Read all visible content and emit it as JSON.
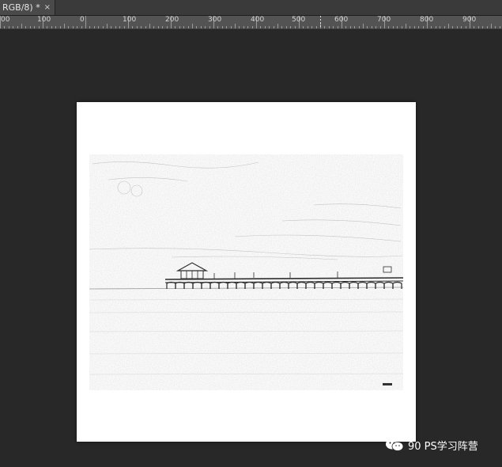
{
  "tabbar": {
    "tab_title": "RGB/8) *",
    "close_glyph": "×"
  },
  "ruler": {
    "labels": [
      "00",
      "100",
      "0",
      "100",
      "200",
      "300",
      "400",
      "500",
      "600",
      "700",
      "800",
      "900"
    ]
  },
  "canvas": {
    "image_description_icon": "pier-sketch-image"
  },
  "watermark": {
    "icon": "wechat-icon",
    "text": "90 PS学习阵营"
  },
  "colors": {
    "workspace_bg": "#282828",
    "tabbar_bg": "#3a3a3a",
    "active_tab_bg": "#4a4a4a",
    "ruler_bg": "#535353",
    "canvas_bg": "#ffffff"
  }
}
